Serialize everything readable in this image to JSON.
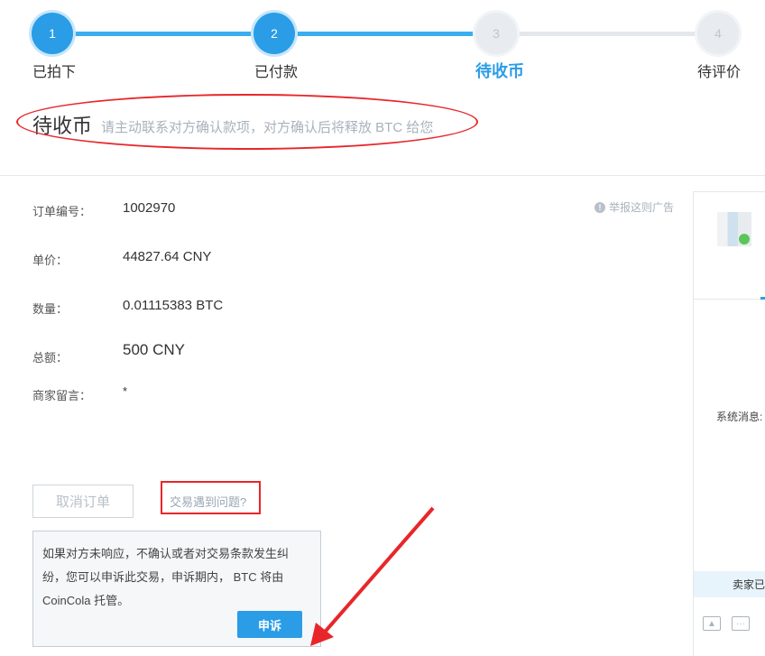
{
  "stepper": {
    "steps": [
      {
        "number": "1",
        "label": "已拍下",
        "state": "done"
      },
      {
        "number": "2",
        "label": "已付款",
        "state": "done"
      },
      {
        "number": "3",
        "label": "待收币",
        "state": "current"
      },
      {
        "number": "4",
        "label": "待评价",
        "state": "todo"
      }
    ]
  },
  "status": {
    "title": "待收币",
    "hint": "请主动联系对方确认款项，对方确认后将释放 BTC 给您"
  },
  "order": {
    "report_link": "举报这则广告",
    "rows": [
      {
        "label": "订单编号：",
        "value": "1002970"
      },
      {
        "label": "单价：",
        "value": "44827.64 CNY"
      },
      {
        "label": "数量：",
        "value": "0.01115383 BTC"
      },
      {
        "label": "总额：",
        "value": "500 CNY"
      },
      {
        "label": "商家留言：",
        "value": "*"
      }
    ]
  },
  "actions": {
    "cancel_label": "取消订单",
    "problem_link": "交易遇到问题?",
    "tip_lines": [
      "如果对方未响应，不确认或者对交易条款发生纠",
      "纷，您可以申诉此交易，申诉期内， BTC 将由",
      "CoinCola 托管。"
    ],
    "appeal_label": "申诉"
  },
  "chat": {
    "system_message_label": "系统消息:",
    "seller_banner": "卖家已"
  },
  "colors": {
    "accent": "#2a9de6",
    "annotation_red": "#e8262a"
  },
  "icons": {
    "report": "info-icon",
    "chat_image": "image-icon",
    "chat_emoji": "chat-bubble-icon"
  }
}
